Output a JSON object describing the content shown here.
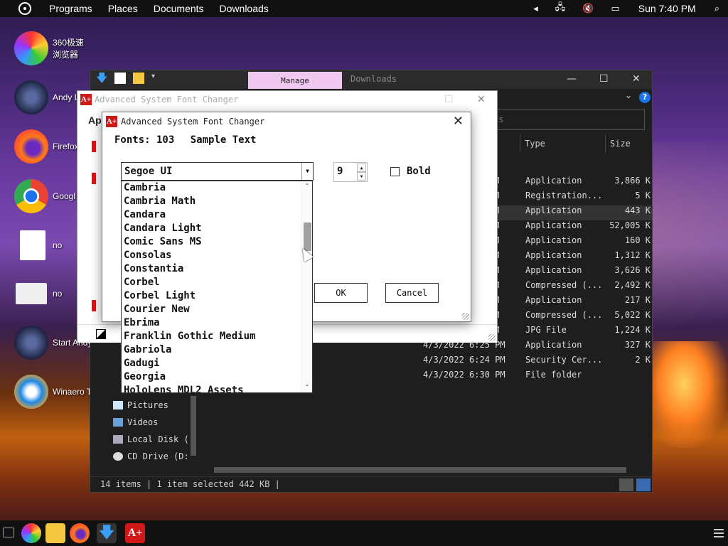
{
  "top_panel": {
    "menus": [
      "Programs",
      "Places",
      "Documents",
      "Downloads"
    ],
    "clock": "Sun 7:40 PM"
  },
  "desktop_icons": [
    {
      "label": "360极速浏览器",
      "icon": "360-browser-icon"
    },
    {
      "label": "Andy L",
      "icon": "andy-icon"
    },
    {
      "label": "Firefox",
      "icon": "firefox-icon"
    },
    {
      "label": "Googl",
      "icon": "chrome-icon"
    },
    {
      "label": "no",
      "icon": "document-icon"
    },
    {
      "label": "no",
      "icon": "settings-file-icon"
    },
    {
      "label": "Start Andy",
      "icon": "andy-start-icon"
    },
    {
      "label": "Winaero T",
      "icon": "winaero-icon"
    }
  ],
  "explorer": {
    "tab_manage": "Manage",
    "tab_downloads": "Downloads",
    "search_placeholder": "ds",
    "columns": {
      "type": "Type",
      "size": "Size"
    },
    "rows": [
      {
        "m": "M",
        "type": "Application",
        "size": "3,866 K"
      },
      {
        "m": "M",
        "type": "Registration...",
        "size": "5 K"
      },
      {
        "m": "M",
        "type": "Application",
        "size": "443 K",
        "selected": true
      },
      {
        "m": "M",
        "type": "Application",
        "size": "52,005 K"
      },
      {
        "m": "M",
        "type": "Application",
        "size": "160 K"
      },
      {
        "m": "M",
        "type": "Application",
        "size": "1,312 K"
      },
      {
        "m": "M",
        "type": "Application",
        "size": "3,626 K"
      },
      {
        "m": "M",
        "type": "Compressed (...",
        "size": "2,492 K"
      },
      {
        "m": "M",
        "type": "Application",
        "size": "217 K"
      },
      {
        "m": "M",
        "type": "Compressed (...",
        "size": "5,022 K"
      },
      {
        "m": "M",
        "type": "JPG File",
        "size": "1,224 K"
      },
      {
        "date": "4/3/2022 6:25 PM",
        "type": "Application",
        "size": "327 K"
      },
      {
        "date": "4/3/2022 6:24 PM",
        "type": "Security Cer...",
        "size": "2 K"
      },
      {
        "date": "4/3/2022 6:30 PM",
        "type": "File folder",
        "size": ""
      }
    ],
    "nav_items": [
      "Pictures",
      "Videos",
      "Local Disk (",
      "CD Drive (D:"
    ],
    "status": "14 items | 1 item selected  442 KB |"
  },
  "asfc_main": {
    "title": "Advanced System Font Changer",
    "heading_partial": "Ap"
  },
  "dialog": {
    "title": "Advanced System Font Changer",
    "fonts_label": "Fonts: 103",
    "sample_label": "Sample Text",
    "selected_font": "Segoe UI",
    "size_value": "9",
    "bold_label": "Bold",
    "ok_label": "OK",
    "cancel_label": "Cancel"
  },
  "font_list": [
    "Cambria",
    "Cambria Math",
    "Candara",
    "Candara Light",
    "Comic Sans MS",
    "Consolas",
    "Constantia",
    "Corbel",
    "Corbel Light",
    "Courier New",
    "Ebrima",
    "Franklin Gothic Medium",
    "Gabriola",
    "Gadugi",
    "Georgia",
    "HoloLens MDL2 Assets"
  ],
  "colors": {
    "accent_red": "#d01818",
    "manage_tab": "#f0c8f0",
    "help_blue": "#1a73e8"
  }
}
